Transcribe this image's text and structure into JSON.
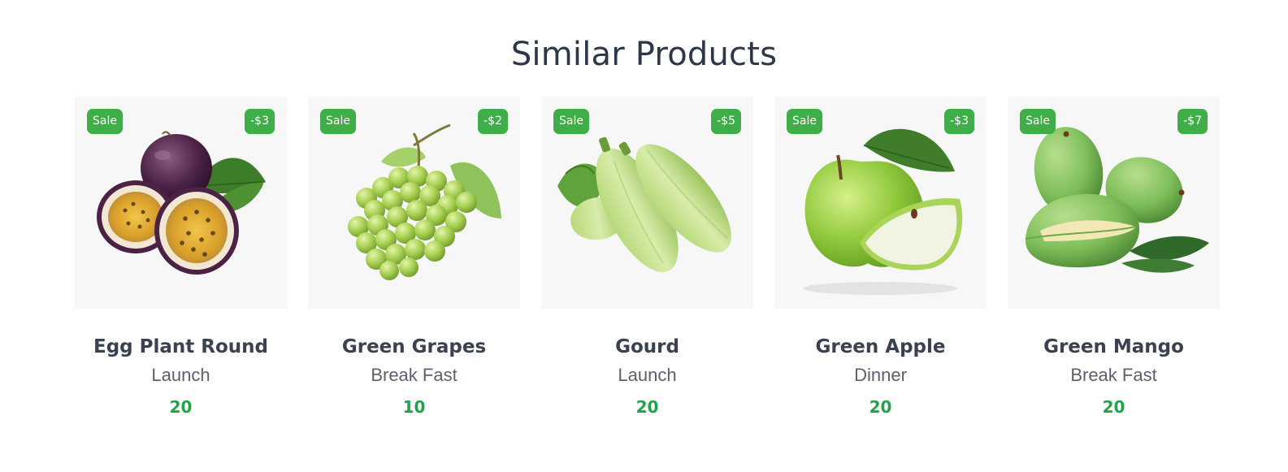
{
  "section": {
    "title": "Similar Products"
  },
  "colors": {
    "badge": "#3fae49",
    "price": "#21a34a",
    "title": "#2d3748",
    "image_bg": "#f7f7f7"
  },
  "products": [
    {
      "name": "Egg Plant Round",
      "category": "Launch",
      "price": "20",
      "sale_label": "Sale",
      "discount": "-$3",
      "image": "passion-fruit"
    },
    {
      "name": "Green Grapes",
      "category": "Break Fast",
      "price": "10",
      "sale_label": "Sale",
      "discount": "-$2",
      "image": "green-grapes"
    },
    {
      "name": "Gourd",
      "category": "Launch",
      "price": "20",
      "sale_label": "Sale",
      "discount": "-$5",
      "image": "zucchini"
    },
    {
      "name": "Green Apple",
      "category": "Dinner",
      "price": "20",
      "sale_label": "Sale",
      "discount": "-$3",
      "image": "green-apple"
    },
    {
      "name": "Green Mango",
      "category": "Break Fast",
      "price": "20",
      "sale_label": "Sale",
      "discount": "-$7",
      "image": "green-mango"
    }
  ]
}
